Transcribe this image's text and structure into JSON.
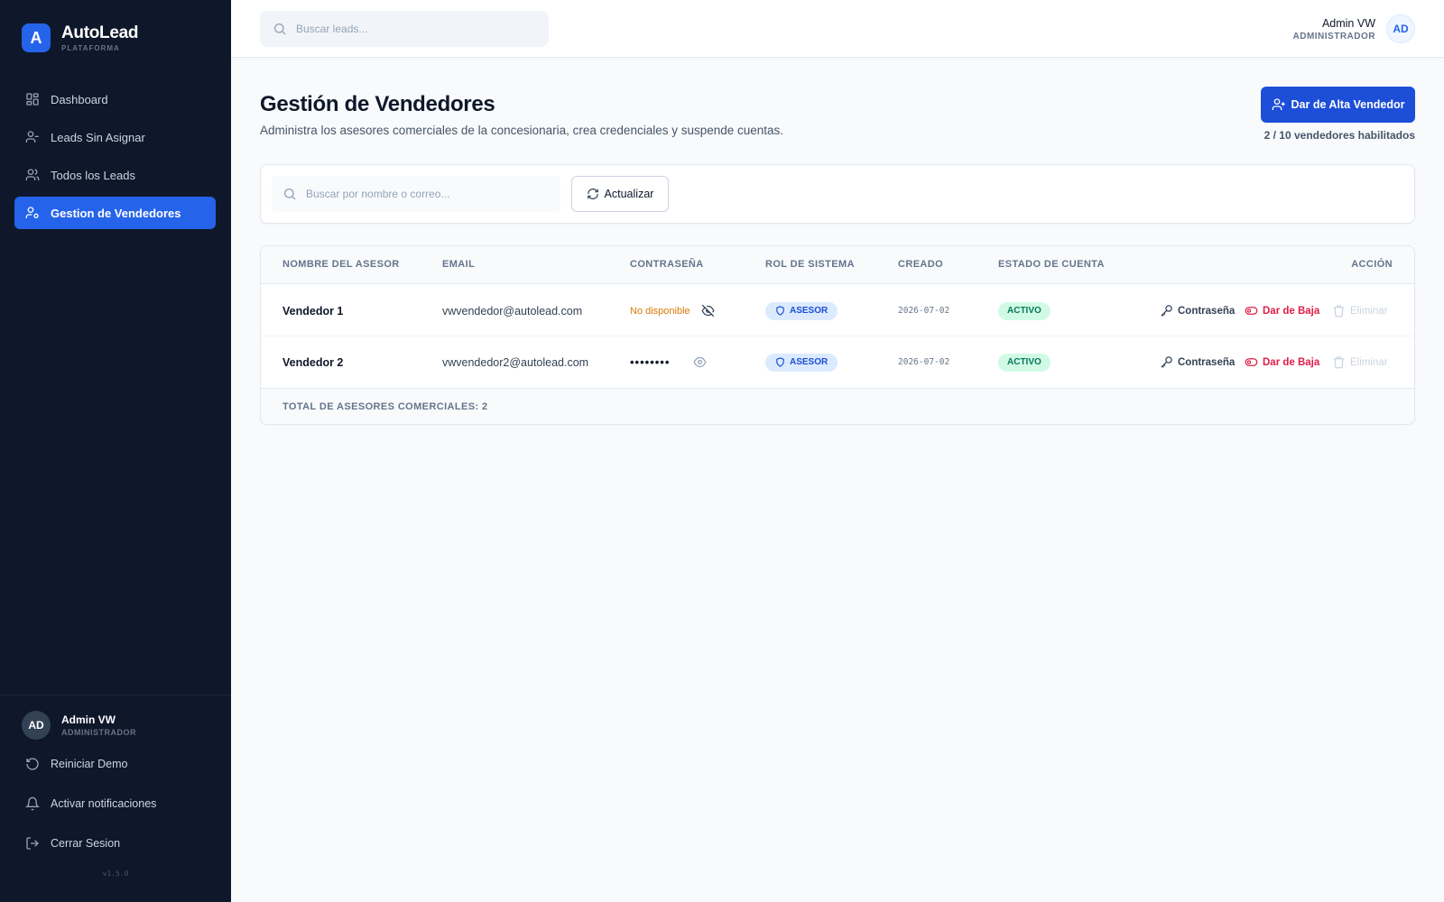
{
  "brand": {
    "logo_letter": "A",
    "name": "AutoLead",
    "subtitle": "PLATAFORMA"
  },
  "sidebar": {
    "nav": [
      {
        "label": "Dashboard",
        "icon": "dashboard-icon"
      },
      {
        "label": "Leads Sin Asignar",
        "icon": "user-minus-icon"
      },
      {
        "label": "Todos los Leads",
        "icon": "users-icon"
      },
      {
        "label": "Gestion de Vendedores",
        "icon": "user-cog-icon",
        "active": true
      }
    ],
    "profile": {
      "initials": "AD",
      "name": "Admin VW",
      "role": "ADMINISTRADOR"
    },
    "actions": [
      {
        "label": "Reiniciar Demo",
        "icon": "rotate-ccw-icon"
      },
      {
        "label": "Activar notificaciones",
        "icon": "bell-icon"
      },
      {
        "label": "Cerrar Sesion",
        "icon": "logout-icon"
      }
    ],
    "version": "v1.5.0"
  },
  "topbar": {
    "search_placeholder": "Buscar leads...",
    "user_name": "Admin VW",
    "user_role": "ADMINISTRADOR",
    "user_initials": "AD"
  },
  "page": {
    "title": "Gestión de Vendedores",
    "description": "Administra los asesores comerciales de la concesionaria, crea credenciales y suspende cuentas.",
    "add_button": "Dar de Alta Vendedor",
    "quota": "2 / 10 vendedores habilitados"
  },
  "filters": {
    "search_placeholder": "Buscar por nombre o correo...",
    "refresh_label": "Actualizar"
  },
  "table": {
    "headers": [
      "NOMBRE DEL ASESOR",
      "EMAIL",
      "CONTRASEÑA",
      "ROL DE SISTEMA",
      "CREADO",
      "ESTADO DE CUENTA",
      "ACCIÓN"
    ],
    "rows": [
      {
        "name": "Vendedor 1",
        "email": "vwvendedor@autolead.com",
        "password": "No disponible",
        "password_icon": "eye-off-icon",
        "role": "ASESOR",
        "created": "2026-07-02",
        "status": "ACTIVO"
      },
      {
        "name": "Vendedor 2",
        "email": "vwvendedor2@autolead.com",
        "password": "••••••••",
        "password_icon": "eye-icon",
        "role": "ASESOR",
        "created": "2026-07-02",
        "status": "ACTIVO"
      }
    ],
    "actions": {
      "password": "Contraseña",
      "deactivate": "Dar de Baja",
      "delete": "Eliminar"
    },
    "footer": "TOTAL DE ASESORES COMERCIALES: 2"
  },
  "colors": {
    "sidebar_bg": "#0f172a",
    "accent": "#2563eb",
    "danger": "#e11d48",
    "success_bg": "#d1fae5",
    "success_text": "#047857",
    "warning": "#d97706"
  }
}
